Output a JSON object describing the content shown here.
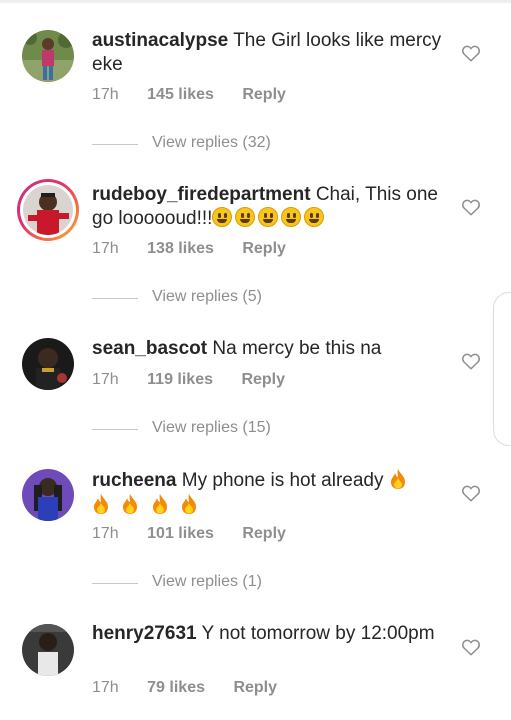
{
  "comments": [
    {
      "username": "austinacalypse",
      "text": "The Girl looks like mercy eke",
      "time": "17h",
      "likes": "145 likes",
      "reply": "Reply",
      "view_replies": "View replies (32)"
    },
    {
      "username": "rudeboy_firedepartment",
      "text": "Chai, This one go loooooud!!!",
      "emoji": "grinning-face-emoji",
      "emoji_count": 5,
      "time": "17h",
      "likes": "138 likes",
      "reply": "Reply",
      "view_replies": "View replies (5)"
    },
    {
      "username": "sean_bascot",
      "text": "Na mercy be this na",
      "time": "17h",
      "likes": "119 likes",
      "reply": "Reply",
      "view_replies": "View replies (15)"
    },
    {
      "username": "rucheena",
      "text": "My phone is hot already",
      "emoji": "fire-emoji",
      "emoji_count": 5,
      "time": "17h",
      "likes": "101 likes",
      "reply": "Reply",
      "view_replies": "View replies (1)"
    },
    {
      "username": "henry27631",
      "text": "Y not tomorrow by 12:00pm",
      "time": "17h",
      "likes": "79 likes",
      "reply": "Reply"
    }
  ],
  "icons": {
    "like": "heart-outline-icon"
  },
  "colors": {
    "text": "#262626",
    "meta": "#8e8e8e",
    "story_ring": "#e1306c"
  }
}
